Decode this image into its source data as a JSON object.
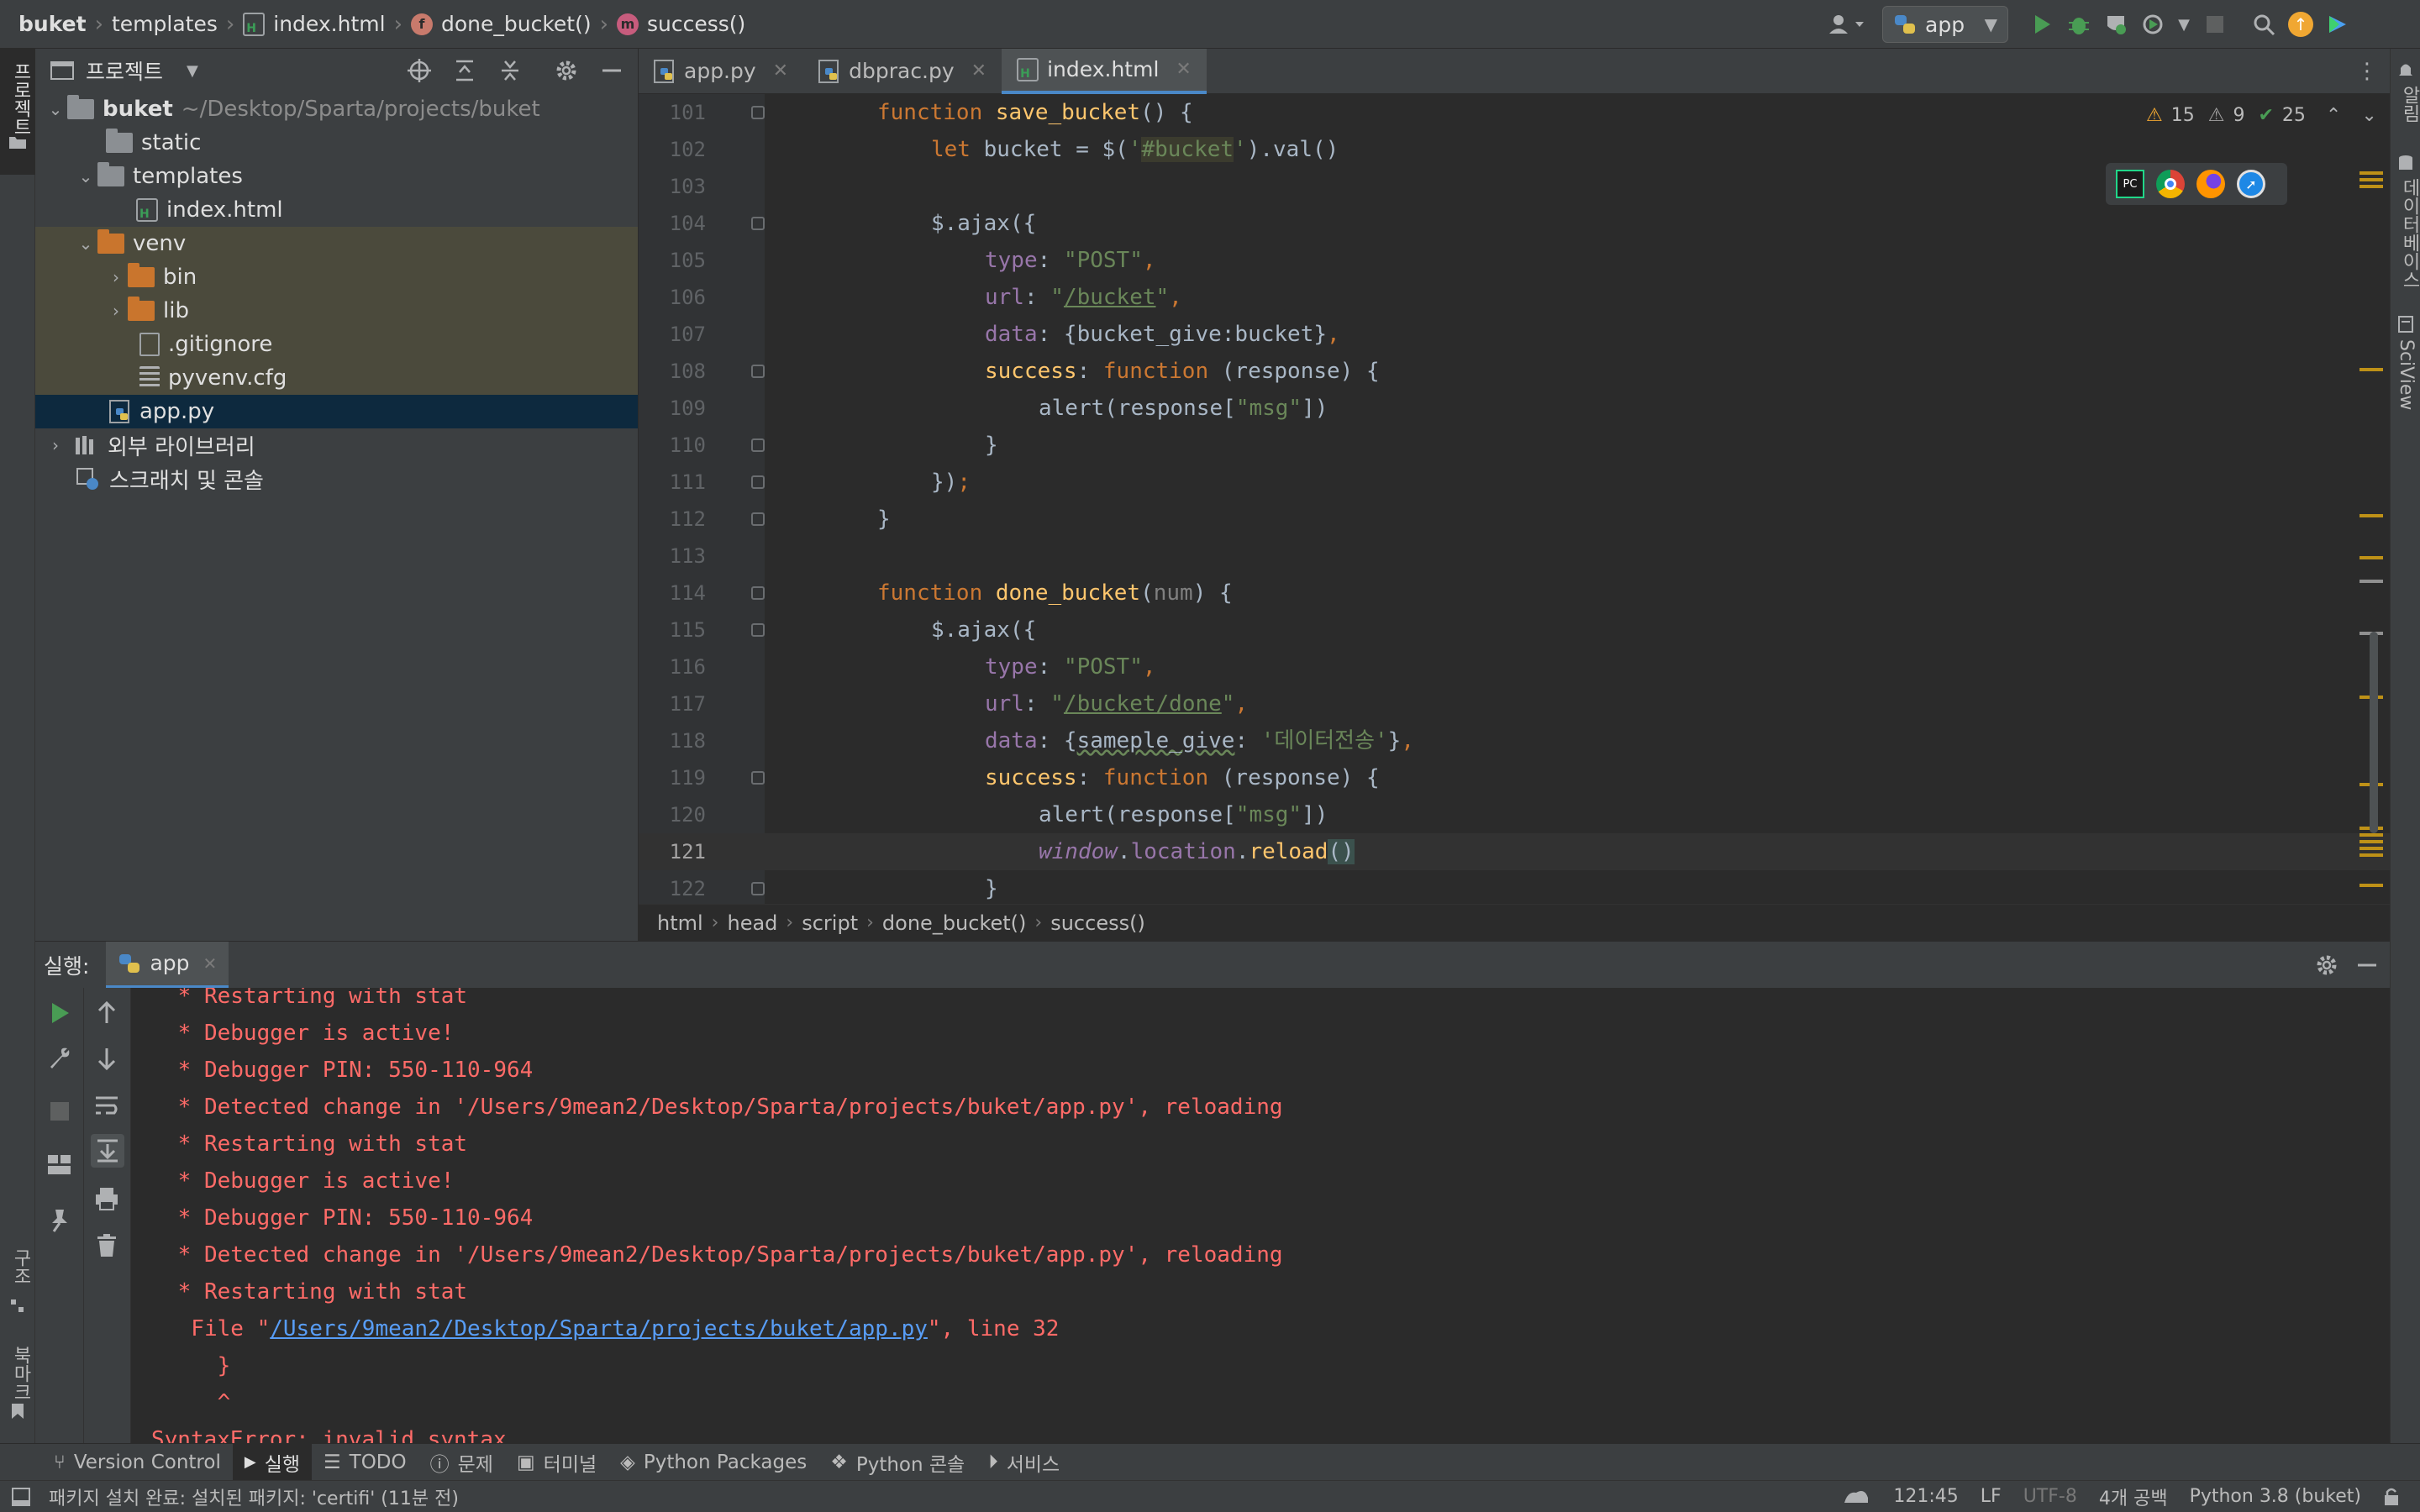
{
  "navbar": {
    "project": "buket",
    "folder": "templates",
    "file": "index.html",
    "fn": "done_bucket()",
    "method": "success()",
    "run_config": "app"
  },
  "left_stripe": {
    "project_tab": "프로젝트",
    "structure_tab": "구조",
    "bookmarks_tab": "북마크"
  },
  "right_stripe": {
    "notifications": "알림",
    "database": "데이터베이스",
    "sciview": "SciView"
  },
  "project_panel": {
    "title": "프로젝트",
    "tree": [
      {
        "label": "buket",
        "hint": "~/Desktop/Sparta/projects/buket"
      },
      {
        "label": "static"
      },
      {
        "label": "templates"
      },
      {
        "label": "index.html"
      },
      {
        "label": "venv"
      },
      {
        "label": "bin"
      },
      {
        "label": "lib"
      },
      {
        "label": ".gitignore"
      },
      {
        "label": "pyvenv.cfg"
      },
      {
        "label": "app.py"
      },
      {
        "label": "외부 라이브러리"
      },
      {
        "label": "스크래치 및 콘솔"
      }
    ]
  },
  "tabs": [
    {
      "label": "app.py"
    },
    {
      "label": "dbprac.py"
    },
    {
      "label": "index.html"
    }
  ],
  "inspections": {
    "warnings": "15",
    "weak": "9",
    "ok": "25"
  },
  "code_lines": [
    "101",
    "102",
    "103",
    "104",
    "105",
    "106",
    "107",
    "108",
    "109",
    "110",
    "111",
    "112",
    "113",
    "114",
    "115",
    "116",
    "117",
    "118",
    "119",
    "120",
    "121",
    "122"
  ],
  "editor_crumbs": [
    "html",
    "head",
    "script",
    "done_bucket()",
    "success()"
  ],
  "run": {
    "label": "실행:",
    "tab": "app"
  },
  "console_lines": [
    " * Restarting with stat",
    " * Debugger is active!",
    " * Debugger PIN: 550-110-964",
    " * Detected change in '/Users/9mean2/Desktop/Sparta/projects/buket/app.py', reloading",
    " * Restarting with stat",
    " * Debugger is active!",
    " * Debugger PIN: 550-110-964",
    " * Detected change in '/Users/9mean2/Desktop/Sparta/projects/buket/app.py', reloading",
    " * Restarting with stat"
  ],
  "console_file": {
    "pre": "  File \"",
    "link": "/Users/9mean2/Desktop/Sparta/projects/buket/app.py",
    "post": "\", line 32"
  },
  "console_tail": [
    "    }",
    "    ^",
    "SyntaxError: invalid syntax"
  ],
  "tool_windows": [
    "Version Control",
    "실행",
    "TODO",
    "문제",
    "터미널",
    "Python Packages",
    "Python 콘솔",
    "서비스"
  ],
  "status": {
    "message": "패키지 설치 완료: 설치된 패키지: 'certifi' (11분 전)",
    "position": "121:45",
    "line_sep": "LF",
    "encoding": "UTF-8",
    "indent": "4개 공백",
    "interpreter": "Python 3.8 (buket)"
  },
  "colors": {
    "accent": "#4a88c7",
    "run_green": "#499c54",
    "warning": "#f0a732",
    "error_text": "#ff6b68"
  }
}
